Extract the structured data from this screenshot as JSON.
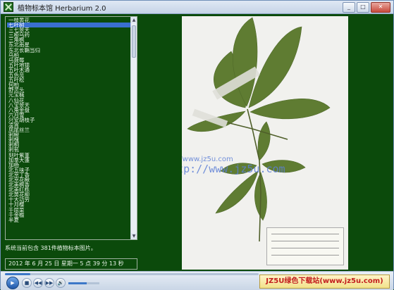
{
  "window": {
    "title": "植物标本馆 Herbarium 2.0",
    "controls": [
      "_",
      "□",
      "✕"
    ]
  },
  "species_list": {
    "selected_index": 1,
    "items": [
      "一枝黄花",
      "七叶树",
      "三七景天",
      "三桠乌药",
      "三角枫",
      "东北南星",
      "东北长鞘当归",
      "乌柏",
      "乌蔹莓",
      "五叶地锦",
      "五叶木通",
      "五色苋",
      "五叶松",
      "何柏",
      "野灵头",
      "元宝槭",
      "八仙花",
      "八宝景天",
      "八角金盘",
      "六月雪",
      "兴安胡枝子",
      "凌霄",
      "凤尾丝兰",
      "刺楸",
      "刺槐",
      "刺桐",
      "刺苞",
      "刻叶紫堇",
      "加拿大蓬",
      "加杨",
      "北五味子",
      "北京丁香",
      "北京花楸",
      "北美枫香",
      "北美红栎",
      "北黄花柳",
      "十大功劳",
      "十月樱",
      "千屈菜",
      "千金榆",
      "半夏"
    ]
  },
  "info": {
    "summary": "系统当前包含 381件植物标本图片。",
    "datetime": "2012 年 6 月 25 日 星期一 5 点 39 分 13 秒"
  },
  "viewer": {
    "watermark_small": "http://www.jz5u.com",
    "watermark_large": "http://www.jz5u.com"
  },
  "player": {
    "play_label": "▶",
    "stop_label": "■",
    "prev_label": "◀◀",
    "next_label": "▶▶",
    "mute_label": "🔊",
    "seek_fraction": 0.1,
    "volume_fraction": 0.6
  },
  "brand": {
    "text": "JZ5U绿色下载站(www.jz5u.com)"
  }
}
